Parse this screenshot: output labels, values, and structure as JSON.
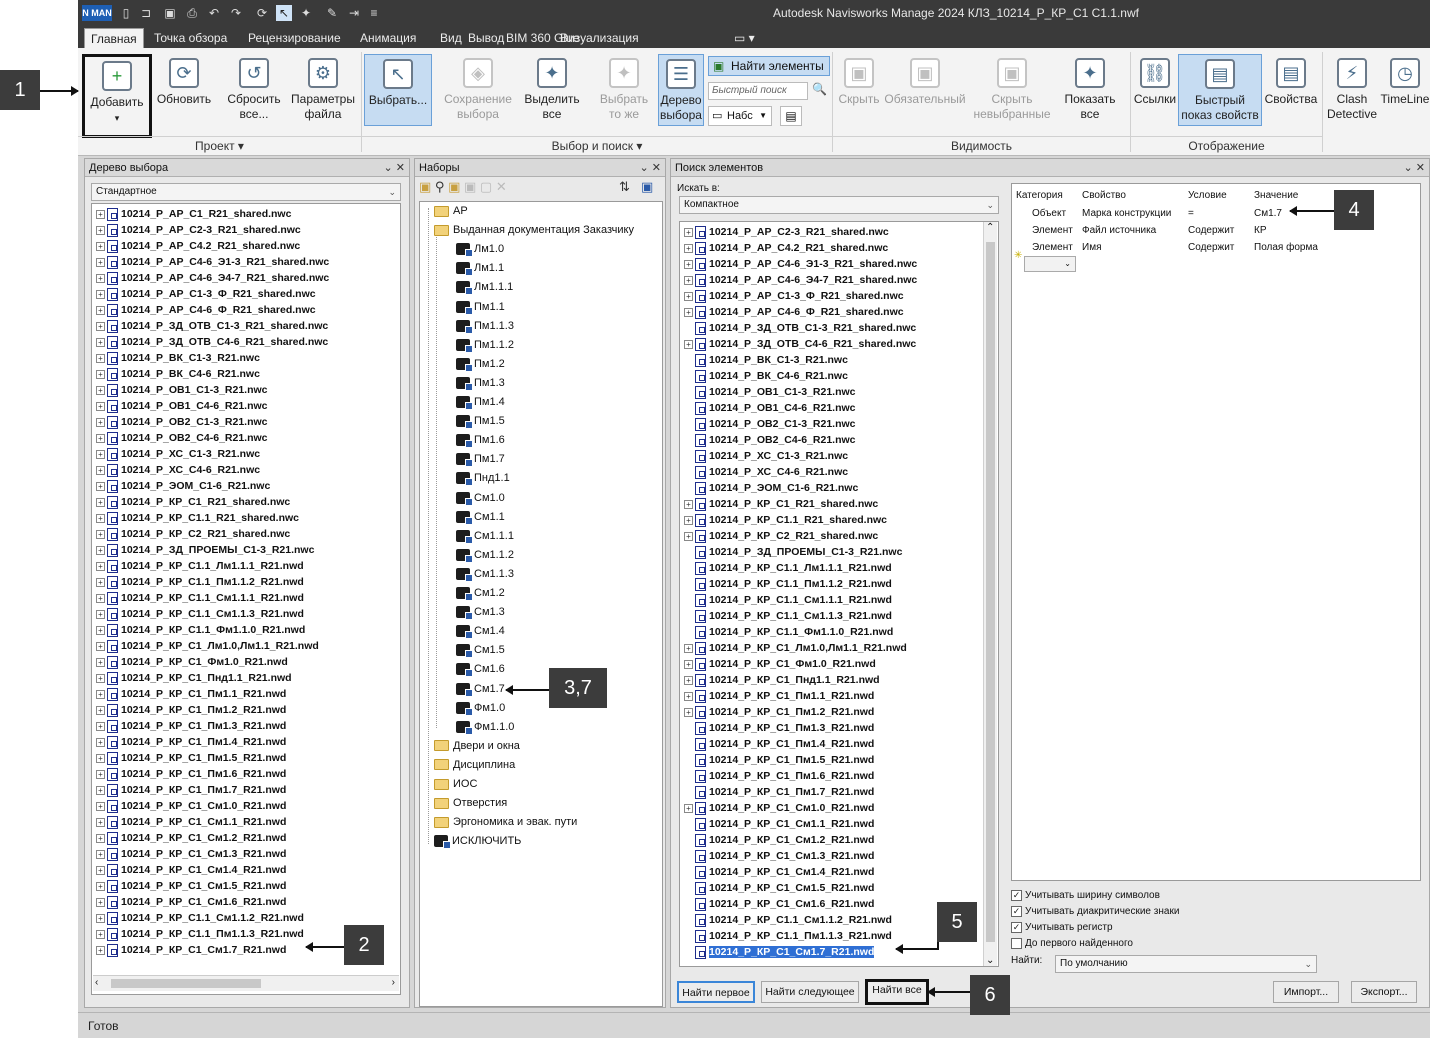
{
  "app": {
    "logo": "N MAN",
    "title": "Autodesk Navisworks Manage 2024    КЛЗ_10214_Р_КР_С1 С1.1.nwf",
    "status": "Готов"
  },
  "menu_tabs": [
    "Главная",
    "Точка обзора",
    "Рецензирование",
    "Анимация",
    "Вид",
    "Вывод",
    "BIM 360 Glue",
    "Визуализация"
  ],
  "ribbon": {
    "add": "Добавить",
    "refresh": "Обновить",
    "reset_all": "Сбросить все...",
    "file_params": "Параметры файла",
    "select": "Выбрать...",
    "save_selection": "Сохранение выбора",
    "select_all": "Выделить все",
    "select_same": "Выбрать то же",
    "selection_tree": "Дерево выбора",
    "find_items": "Найти элементы",
    "quick_find": "Быстрый поиск",
    "sets_combo": "Набс",
    "hide": "Скрыть",
    "required": "Обязательный",
    "hide_unselected": "Скрыть невыбранные",
    "show_all": "Показать все",
    "links": "Ссылки",
    "quick_props": "Быстрый показ свойств",
    "properties": "Свойства",
    "clash": "Clash Detective",
    "timeliner": "TimeLine",
    "group_project": "Проект",
    "group_select": "Выбор и поиск",
    "group_visibility": "Видимость",
    "group_display": "Отображение"
  },
  "tree_panel": {
    "title": "Дерево выбора",
    "combo": "Стандартное",
    "items": [
      {
        "t": "10214_Р_АР_С1_R21_shared.nwc",
        "exp": true
      },
      {
        "t": "10214_Р_АР_С2-3_R21_shared.nwc",
        "exp": true
      },
      {
        "t": "10214_Р_АР_С4.2_R21_shared.nwc",
        "exp": true
      },
      {
        "t": "10214_Р_АР_С4-6_Э1-3_R21_shared.nwc",
        "exp": true
      },
      {
        "t": "10214_Р_АР_С4-6_Э4-7_R21_shared.nwc",
        "exp": true
      },
      {
        "t": "10214_Р_АР_С1-3_Ф_R21_shared.nwc",
        "exp": true
      },
      {
        "t": "10214_Р_АР_С4-6_Ф_R21_shared.nwc",
        "exp": true
      },
      {
        "t": "10214_Р_ЗД_ОТВ_С1-3_R21_shared.nwc",
        "exp": true
      },
      {
        "t": "10214_Р_ЗД_ОТВ_С4-6_R21_shared.nwc",
        "exp": true
      },
      {
        "t": "10214_Р_ВК_С1-3_R21.nwc",
        "exp": true
      },
      {
        "t": "10214_Р_ВК_С4-6_R21.nwc",
        "exp": true
      },
      {
        "t": "10214_Р_ОВ1_С1-3_R21.nwc",
        "exp": true
      },
      {
        "t": "10214_Р_ОВ1_С4-6_R21.nwc",
        "exp": true
      },
      {
        "t": "10214_Р_ОВ2_С1-3_R21.nwc",
        "exp": true
      },
      {
        "t": "10214_Р_ОВ2_С4-6_R21.nwc",
        "exp": true
      },
      {
        "t": "10214_Р_ХС_С1-3_R21.nwc",
        "exp": true
      },
      {
        "t": "10214_Р_ХС_С4-6_R21.nwc",
        "exp": true
      },
      {
        "t": "10214_Р_ЭОМ_С1-6_R21.nwc",
        "exp": true
      },
      {
        "t": "10214_Р_КР_С1_R21_shared.nwc",
        "exp": true
      },
      {
        "t": "10214_Р_КР_С1.1_R21_shared.nwc",
        "exp": true
      },
      {
        "t": "10214_Р_КР_С2_R21_shared.nwc",
        "exp": true
      },
      {
        "t": "10214_Р_ЗД_ПРОЕМЫ_С1-3_R21.nwc",
        "exp": true
      },
      {
        "t": "10214_Р_КР_С1.1_Лм1.1.1_R21.nwd",
        "exp": true
      },
      {
        "t": "10214_Р_КР_С1.1_Пм1.1.2_R21.nwd",
        "exp": true
      },
      {
        "t": "10214_Р_КР_С1.1_См1.1.1_R21.nwd",
        "exp": true
      },
      {
        "t": "10214_Р_КР_С1.1_См1.1.3_R21.nwd",
        "exp": true
      },
      {
        "t": "10214_Р_КР_С1.1_Фм1.1.0_R21.nwd",
        "exp": true
      },
      {
        "t": "10214_Р_КР_С1_Лм1.0,Лм1.1_R21.nwd",
        "exp": true
      },
      {
        "t": "10214_Р_КР_С1_Фм1.0_R21.nwd",
        "exp": true
      },
      {
        "t": "10214_Р_КР_С1_Пнд1.1_R21.nwd",
        "exp": true
      },
      {
        "t": "10214_Р_КР_С1_Пм1.1_R21.nwd",
        "exp": true
      },
      {
        "t": "10214_Р_КР_С1_Пм1.2_R21.nwd",
        "exp": true
      },
      {
        "t": "10214_Р_КР_С1_Пм1.3_R21.nwd",
        "exp": true
      },
      {
        "t": "10214_Р_КР_С1_Пм1.4_R21.nwd",
        "exp": true
      },
      {
        "t": "10214_Р_КР_С1_Пм1.5_R21.nwd",
        "exp": true
      },
      {
        "t": "10214_Р_КР_С1_Пм1.6_R21.nwd",
        "exp": true
      },
      {
        "t": "10214_Р_КР_С1_Пм1.7_R21.nwd",
        "exp": true
      },
      {
        "t": "10214_Р_КР_С1_См1.0_R21.nwd",
        "exp": true
      },
      {
        "t": "10214_Р_КР_С1_См1.1_R21.nwd",
        "exp": true
      },
      {
        "t": "10214_Р_КР_С1_См1.2_R21.nwd",
        "exp": true
      },
      {
        "t": "10214_Р_КР_С1_См1.3_R21.nwd",
        "exp": true
      },
      {
        "t": "10214_Р_КР_С1_См1.4_R21.nwd",
        "exp": true
      },
      {
        "t": "10214_Р_КР_С1_См1.5_R21.nwd",
        "exp": true
      },
      {
        "t": "10214_Р_КР_С1_См1.6_R21.nwd",
        "exp": true
      },
      {
        "t": "10214_Р_КР_С1.1_См1.1.2_R21.nwd",
        "exp": true
      },
      {
        "t": "10214_Р_КР_С1.1_Пм1.1.3_R21.nwd",
        "exp": true
      },
      {
        "t": "10214_Р_КР_С1_См1.7_R21.nwd",
        "exp": true
      }
    ]
  },
  "sets_panel": {
    "title": "Наборы",
    "items": [
      {
        "t": "АР",
        "k": "folder",
        "lvl": 0
      },
      {
        "t": "Выданная документация Заказчику",
        "k": "folder",
        "lvl": 0
      },
      {
        "t": "Лм1.0",
        "k": "set",
        "lvl": 1
      },
      {
        "t": "Лм1.1",
        "k": "set",
        "lvl": 1
      },
      {
        "t": "Лм1.1.1",
        "k": "set",
        "lvl": 1
      },
      {
        "t": "Пм1.1",
        "k": "set",
        "lvl": 1
      },
      {
        "t": "Пм1.1.3",
        "k": "set",
        "lvl": 1
      },
      {
        "t": "Пм1.1.2",
        "k": "set",
        "lvl": 1
      },
      {
        "t": "Пм1.2",
        "k": "set",
        "lvl": 1
      },
      {
        "t": "Пм1.3",
        "k": "set",
        "lvl": 1
      },
      {
        "t": "Пм1.4",
        "k": "set",
        "lvl": 1
      },
      {
        "t": "Пм1.5",
        "k": "set",
        "lvl": 1
      },
      {
        "t": "Пм1.6",
        "k": "set",
        "lvl": 1
      },
      {
        "t": "Пм1.7",
        "k": "set",
        "lvl": 1
      },
      {
        "t": "Пнд1.1",
        "k": "set",
        "lvl": 1
      },
      {
        "t": "См1.0",
        "k": "set",
        "lvl": 1
      },
      {
        "t": "См1.1",
        "k": "set",
        "lvl": 1
      },
      {
        "t": "См1.1.1",
        "k": "set",
        "lvl": 1
      },
      {
        "t": "См1.1.2",
        "k": "set",
        "lvl": 1
      },
      {
        "t": "См1.1.3",
        "k": "set",
        "lvl": 1
      },
      {
        "t": "См1.2",
        "k": "set",
        "lvl": 1
      },
      {
        "t": "См1.3",
        "k": "set",
        "lvl": 1
      },
      {
        "t": "См1.4",
        "k": "set",
        "lvl": 1
      },
      {
        "t": "См1.5",
        "k": "set",
        "lvl": 1
      },
      {
        "t": "См1.6",
        "k": "set",
        "lvl": 1
      },
      {
        "t": "См1.7",
        "k": "set",
        "lvl": 1
      },
      {
        "t": "Фм1.0",
        "k": "set",
        "lvl": 1
      },
      {
        "t": "Фм1.1.0",
        "k": "set",
        "lvl": 1
      },
      {
        "t": "Двери и окна",
        "k": "folder",
        "lvl": 0
      },
      {
        "t": "Дисциплина",
        "k": "folder",
        "lvl": 0
      },
      {
        "t": "ИОС",
        "k": "folder",
        "lvl": 0
      },
      {
        "t": "Отверстия",
        "k": "folder",
        "lvl": 0
      },
      {
        "t": "Эргономика и эвак. пути",
        "k": "folder",
        "lvl": 0
      },
      {
        "t": "ИСКЛЮЧИТЬ",
        "k": "set",
        "lvl": 0
      }
    ]
  },
  "find_panel": {
    "title": "Поиск элементов",
    "search_in_label": "Искать в:",
    "search_in_value": "Компактное",
    "columns": [
      "Категория",
      "Свойство",
      "Условие",
      "Значение"
    ],
    "conditions": [
      {
        "cat": "Объект",
        "prop": "Марка конструкции",
        "cond": "=",
        "val": "См1.7"
      },
      {
        "cat": "Элемент",
        "prop": "Файл источника",
        "cond": "Содержит",
        "val": "КР"
      },
      {
        "cat": "Элемент",
        "prop": "Имя",
        "cond": "Содержит",
        "val": "Полая форма"
      }
    ],
    "items": [
      {
        "t": "10214_Р_АР_С2-3_R21_shared.nwc",
        "exp": true
      },
      {
        "t": "10214_Р_АР_С4.2_R21_shared.nwc",
        "exp": true
      },
      {
        "t": "10214_Р_АР_С4-6_Э1-3_R21_shared.nwc",
        "exp": true
      },
      {
        "t": "10214_Р_АР_С4-6_Э4-7_R21_shared.nwc",
        "exp": true
      },
      {
        "t": "10214_Р_АР_С1-3_Ф_R21_shared.nwc",
        "exp": true
      },
      {
        "t": "10214_Р_АР_С4-6_Ф_R21_shared.nwc",
        "exp": true
      },
      {
        "t": "10214_Р_ЗД_ОТВ_С1-3_R21_shared.nwc",
        "exp": false
      },
      {
        "t": "10214_Р_ЗД_ОТВ_С4-6_R21_shared.nwc",
        "exp": true
      },
      {
        "t": "10214_Р_ВК_С1-3_R21.nwc",
        "exp": false
      },
      {
        "t": "10214_Р_ВК_С4-6_R21.nwc",
        "exp": false
      },
      {
        "t": "10214_Р_ОВ1_С1-3_R21.nwc",
        "exp": false
      },
      {
        "t": "10214_Р_ОВ1_С4-6_R21.nwc",
        "exp": false
      },
      {
        "t": "10214_Р_ОВ2_С1-3_R21.nwc",
        "exp": false
      },
      {
        "t": "10214_Р_ОВ2_С4-6_R21.nwc",
        "exp": false
      },
      {
        "t": "10214_Р_ХС_С1-3_R21.nwc",
        "exp": false
      },
      {
        "t": "10214_Р_ХС_С4-6_R21.nwc",
        "exp": false
      },
      {
        "t": "10214_Р_ЭОМ_С1-6_R21.nwc",
        "exp": false
      },
      {
        "t": "10214_Р_КР_С1_R21_shared.nwc",
        "exp": true
      },
      {
        "t": "10214_Р_КР_С1.1_R21_shared.nwc",
        "exp": true
      },
      {
        "t": "10214_Р_КР_С2_R21_shared.nwc",
        "exp": true
      },
      {
        "t": "10214_Р_ЗД_ПРОЕМЫ_С1-3_R21.nwc",
        "exp": false
      },
      {
        "t": "10214_Р_КР_С1.1_Лм1.1.1_R21.nwd",
        "exp": false
      },
      {
        "t": "10214_Р_КР_С1.1_Пм1.1.2_R21.nwd",
        "exp": false
      },
      {
        "t": "10214_Р_КР_С1.1_См1.1.1_R21.nwd",
        "exp": false
      },
      {
        "t": "10214_Р_КР_С1.1_См1.1.3_R21.nwd",
        "exp": false
      },
      {
        "t": "10214_Р_КР_С1.1_Фм1.1.0_R21.nwd",
        "exp": false
      },
      {
        "t": "10214_Р_КР_С1_Лм1.0,Лм1.1_R21.nwd",
        "exp": true
      },
      {
        "t": "10214_Р_КР_С1_Фм1.0_R21.nwd",
        "exp": true
      },
      {
        "t": "10214_Р_КР_С1_Пнд1.1_R21.nwd",
        "exp": true
      },
      {
        "t": "10214_Р_КР_С1_Пм1.1_R21.nwd",
        "exp": true
      },
      {
        "t": "10214_Р_КР_С1_Пм1.2_R21.nwd",
        "exp": true
      },
      {
        "t": "10214_Р_КР_С1_Пм1.3_R21.nwd",
        "exp": false
      },
      {
        "t": "10214_Р_КР_С1_Пм1.4_R21.nwd",
        "exp": false
      },
      {
        "t": "10214_Р_КР_С1_Пм1.5_R21.nwd",
        "exp": false
      },
      {
        "t": "10214_Р_КР_С1_Пм1.6_R21.nwd",
        "exp": false
      },
      {
        "t": "10214_Р_КР_С1_Пм1.7_R21.nwd",
        "exp": false
      },
      {
        "t": "10214_Р_КР_С1_См1.0_R21.nwd",
        "exp": true
      },
      {
        "t": "10214_Р_КР_С1_См1.1_R21.nwd",
        "exp": false
      },
      {
        "t": "10214_Р_КР_С1_См1.2_R21.nwd",
        "exp": false
      },
      {
        "t": "10214_Р_КР_С1_См1.3_R21.nwd",
        "exp": false
      },
      {
        "t": "10214_Р_КР_С1_См1.4_R21.nwd",
        "exp": false
      },
      {
        "t": "10214_Р_КР_С1_См1.5_R21.nwd",
        "exp": false
      },
      {
        "t": "10214_Р_КР_С1_См1.6_R21.nwd",
        "exp": false
      },
      {
        "t": "10214_Р_КР_С1.1_См1.1.2_R21.nwd",
        "exp": false
      },
      {
        "t": "10214_Р_КР_С1.1_Пм1.1.3_R21.nwd",
        "exp": false
      },
      {
        "t": "10214_Р_КР_С1_См1.7_R21.nwd",
        "exp": false,
        "sel": true
      }
    ],
    "options": [
      {
        "t": "Учитывать ширину символов",
        "c": true
      },
      {
        "t": "Учитывать диакритические знаки",
        "c": true
      },
      {
        "t": "Учитывать регистр",
        "c": true
      },
      {
        "t": "До первого найденного",
        "c": false
      }
    ],
    "find_label": "Найти:",
    "find_value": "По умолчанию",
    "btn_first": "Найти первое",
    "btn_next": "Найти следующее",
    "btn_all": "Найти все",
    "btn_import": "Импорт...",
    "btn_export": "Экспорт..."
  },
  "callouts": [
    "1",
    "2",
    "3,7",
    "4",
    "5",
    "6"
  ]
}
